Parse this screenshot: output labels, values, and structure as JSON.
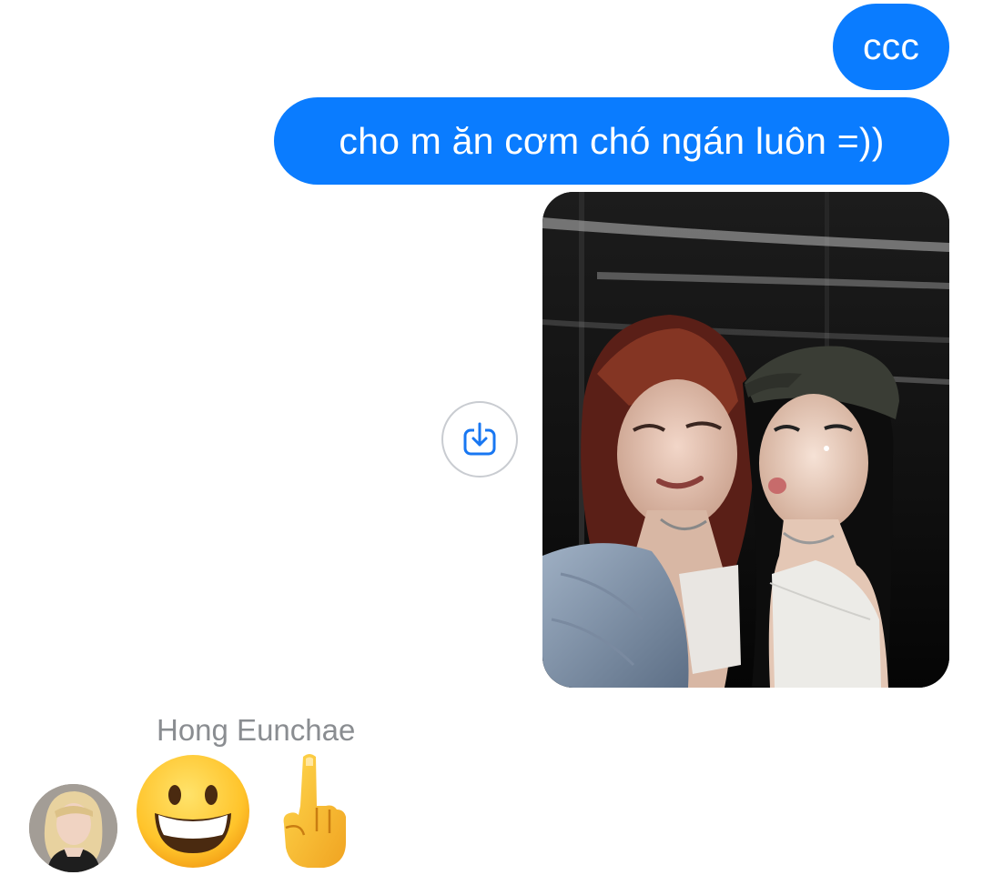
{
  "conversation": {
    "outgoing_messages": [
      {
        "text": "ccc"
      },
      {
        "text": "cho m ăn cơm chó ngán luôn =))"
      }
    ],
    "outgoing_photo": {
      "description_icon": "photo-two-women-in-elevator"
    },
    "save_button": {
      "icon": "download-icon"
    },
    "incoming": {
      "sender_name": "Hong Eunchae",
      "avatar_icon": "avatar-photo",
      "reactions": [
        "grinning-face-emoji",
        "middle-finger-emoji"
      ]
    }
  },
  "colors": {
    "outgoing_bubble": "#0a7cff",
    "outgoing_text": "#ffffff",
    "sender_name": "#8a8d91",
    "icon_accent": "#1877f2"
  }
}
